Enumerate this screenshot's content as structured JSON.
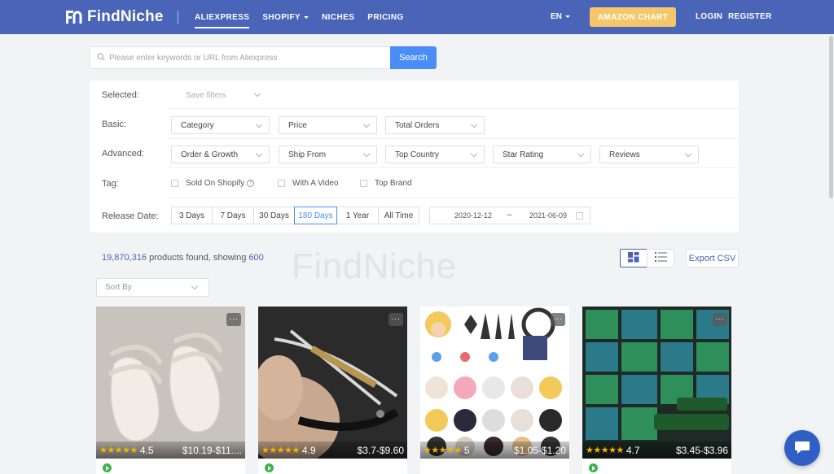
{
  "header": {
    "logo_text": "FindNiche",
    "nav": [
      {
        "label": "ALIEXPRESS",
        "active": true
      },
      {
        "label": "SHOPIFY"
      },
      {
        "label": "NICHES"
      },
      {
        "label": "PRICING"
      }
    ],
    "lang": "EN",
    "amazon_label": "AMAZON CHART",
    "login_label": "LOGIN",
    "register_label": "REGISTER"
  },
  "search": {
    "placeholder": "Please enter keywords or URL from Aliexpress",
    "button_label": "Search"
  },
  "filters": {
    "selected_label": "Selected:",
    "save_filters": "Save filters",
    "basic_label": "Basic:",
    "basic": [
      "Category",
      "Price",
      "Total Orders"
    ],
    "advanced_label": "Advanced:",
    "advanced": [
      "Order & Growth",
      "Ship From",
      "Top Country",
      "Star Rating",
      "Reviews"
    ],
    "tag_label": "Tag:",
    "tags": [
      "Sold On Shopify",
      "With A Video",
      "Top Brand"
    ],
    "release_label": "Release Date:",
    "release_options": [
      "3 Days",
      "7 Days",
      "30 Days",
      "180 Days",
      "1 Year",
      "All Time"
    ],
    "release_active": "180 Days",
    "date_from": "2020-12-12",
    "date_sep": "~",
    "date_to": "2021-06-09"
  },
  "results": {
    "count": "19,870,316",
    "found_text": " products found, showing ",
    "showing": "600",
    "watermark": "FindNiche",
    "export_label": "Export CSV",
    "sort_placeholder": "Sort By"
  },
  "products": [
    {
      "rating": "4.5",
      "price": "$10.19-$11....",
      "has_video": true
    },
    {
      "rating": "4.9",
      "price": "$3.7-$9.60",
      "has_video": true
    },
    {
      "rating": "5",
      "price": "$1.05-$1.20",
      "has_video": false
    },
    {
      "rating": "4.7",
      "price": "$3.45-$3.96",
      "has_video": true
    }
  ],
  "colors": {
    "header_bg": "#4a64b8",
    "accent_blue": "#4a8df6",
    "amazon_btn": "#f6c76a",
    "star": "#f4b400",
    "video_green": "#3bb54a"
  }
}
